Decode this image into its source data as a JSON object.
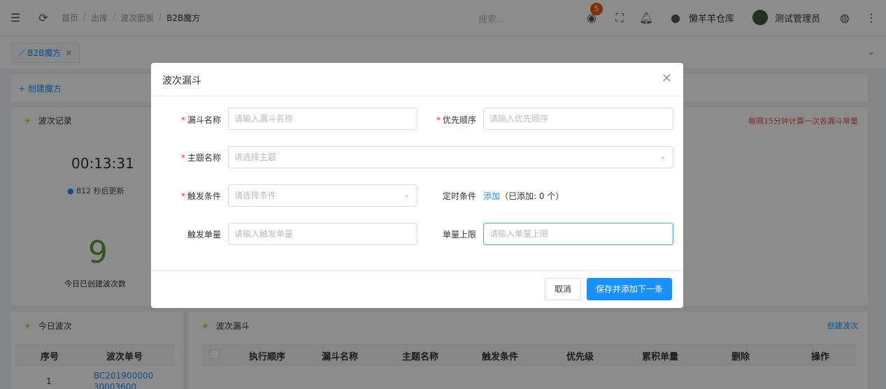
{
  "header": {
    "breadcrumbs": [
      "首页",
      "出库",
      "波次面板",
      "B2B魔方"
    ],
    "search_placeholder": "搜索...",
    "notification_count": "5",
    "warehouse": "懒羊羊仓库",
    "user": "测试管理员"
  },
  "tabs": [
    {
      "label": "B2B魔方"
    }
  ],
  "page": {
    "create_label": "+ 创建魔方",
    "wave_record_title": "波次记录",
    "timer": "00:13:31",
    "refresh_text": "812 秒后更新",
    "today_count": "9",
    "today_count_label": "今日已创建波次数",
    "right_note": "每隔15分钟计算一次各漏斗单量",
    "today_wave_title": "今日波次",
    "today_wave_columns": [
      "序号",
      "波次单号"
    ],
    "today_wave_rows": [
      {
        "index": "1",
        "number": "BC201900000 30003600"
      }
    ],
    "funnel_title": "波次漏斗",
    "create_wave": "创建波次",
    "funnel_columns": [
      "执行顺序",
      "漏斗名称",
      "主题名称",
      "触发条件",
      "优先级",
      "累积单量",
      "删除",
      "操作"
    ]
  },
  "modal": {
    "title": "波次漏斗",
    "funnel_name_label": "漏斗名称",
    "funnel_name_placeholder": "请输入漏斗名称",
    "priority_label": "优先顺序",
    "priority_placeholder": "请输入优先顺序",
    "theme_label": "主题名称",
    "theme_placeholder": "请选择主题",
    "trigger_label": "触发条件",
    "trigger_placeholder": "请选择条件",
    "timed_label": "定时条件",
    "timed_add": "添加",
    "timed_added": "（已添加: 0 个）",
    "trigger_qty_label": "触发单量",
    "trigger_qty_placeholder": "请输入触发单量",
    "max_qty_label": "单量上限",
    "max_qty_placeholder": "请输入单量上限",
    "cancel": "取消",
    "save_next": "保存并添加下一条"
  },
  "colors": {
    "primary": "#1890ff",
    "required": "#f5222d",
    "badge": "#e8590c",
    "highlight_number": "#5c9c3a",
    "note_red": "#e05a4f"
  }
}
